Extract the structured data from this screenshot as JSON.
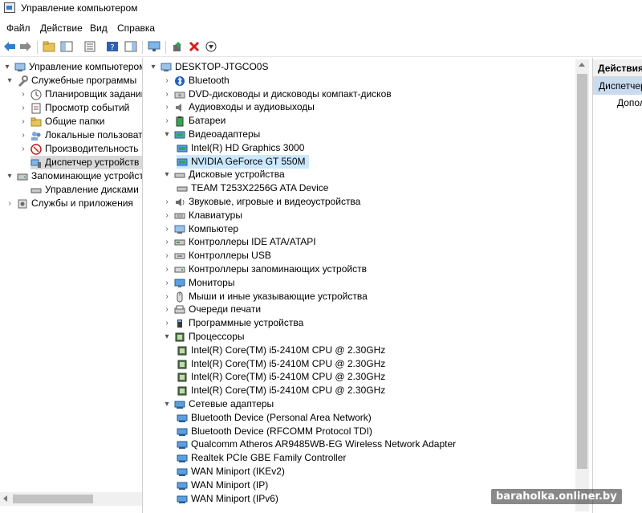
{
  "window": {
    "title": "Управление компьютером"
  },
  "menu": {
    "items": [
      "Файл",
      "Действие",
      "Вид",
      "Справка"
    ]
  },
  "toolbar": {
    "buttons": [
      "back-icon",
      "forward-icon",
      "up-folder-icon",
      "show-hide-tree-icon",
      "properties-icon",
      "help-icon",
      "action-pane-icon",
      "display-icon",
      "update-driver-icon",
      "uninstall-icon",
      "disable-device-icon"
    ]
  },
  "left_tree": {
    "items": [
      {
        "label": "Управление компьютером (л",
        "icon": "computer-management-icon",
        "expander": "▾"
      },
      {
        "label": "Служебные программы",
        "icon": "tools-icon",
        "expander": "▾"
      },
      {
        "label": "Планировщик заданий",
        "icon": "task-scheduler-icon",
        "expander": "›"
      },
      {
        "label": "Просмотр событий",
        "icon": "event-viewer-icon",
        "expander": "›"
      },
      {
        "label": "Общие папки",
        "icon": "shared-folders-icon",
        "expander": "›"
      },
      {
        "label": "Локальные пользовате",
        "icon": "local-users-icon",
        "expander": "›"
      },
      {
        "label": "Производительность",
        "icon": "performance-icon",
        "expander": "›"
      },
      {
        "label": "Диспетчер устройств",
        "icon": "device-manager-icon",
        "expander": ""
      },
      {
        "label": "Запоминающие устройст",
        "icon": "storage-icon",
        "expander": "▾"
      },
      {
        "label": "Управление дисками",
        "icon": "disk-management-icon",
        "expander": ""
      },
      {
        "label": "Службы и приложения",
        "icon": "services-icon",
        "expander": "›"
      }
    ]
  },
  "device_tree": {
    "root": "DESKTOP-JTGCO0S",
    "items": [
      {
        "label": "Bluetooth",
        "icon": "bluetooth-icon",
        "expander": "›"
      },
      {
        "label": "DVD-дисководы и дисководы компакт-дисков",
        "icon": "dvd-drive-icon",
        "expander": "›"
      },
      {
        "label": "Аудиовходы и аудиовыходы",
        "icon": "audio-icon",
        "expander": "›"
      },
      {
        "label": "Батареи",
        "icon": "battery-icon",
        "expander": "›"
      },
      {
        "label": "Видеоадаптеры",
        "icon": "display-adapter-icon",
        "expander": "▾"
      },
      {
        "label": "Intel(R) HD Graphics 3000",
        "icon": "display-adapter-icon",
        "expander": ""
      },
      {
        "label": "NVIDIA GeForce GT 550M",
        "icon": "display-adapter-icon",
        "expander": ""
      },
      {
        "label": "Дисковые устройства",
        "icon": "disk-drive-icon",
        "expander": "▾"
      },
      {
        "label": "TEAM T253X2256G ATA Device",
        "icon": "disk-drive-icon",
        "expander": ""
      },
      {
        "label": "Звуковые, игровые и видеоустройства",
        "icon": "sound-icon",
        "expander": "›"
      },
      {
        "label": "Клавиатуры",
        "icon": "keyboard-icon",
        "expander": "›"
      },
      {
        "label": "Компьютер",
        "icon": "computer-icon",
        "expander": "›"
      },
      {
        "label": "Контроллеры IDE ATA/ATAPI",
        "icon": "ide-controller-icon",
        "expander": "›"
      },
      {
        "label": "Контроллеры USB",
        "icon": "usb-icon",
        "expander": "›"
      },
      {
        "label": "Контроллеры запоминающих устройств",
        "icon": "storage-controller-icon",
        "expander": "›"
      },
      {
        "label": "Мониторы",
        "icon": "monitor-icon",
        "expander": "›"
      },
      {
        "label": "Мыши и иные указывающие устройства",
        "icon": "mouse-icon",
        "expander": "›"
      },
      {
        "label": "Очереди печати",
        "icon": "printer-icon",
        "expander": "›"
      },
      {
        "label": "Программные устройства",
        "icon": "software-device-icon",
        "expander": "›"
      },
      {
        "label": "Процессоры",
        "icon": "processor-icon",
        "expander": "▾"
      },
      {
        "label": "Intel(R) Core(TM) i5-2410M CPU @ 2.30GHz",
        "icon": "processor-icon",
        "expander": ""
      },
      {
        "label": "Intel(R) Core(TM) i5-2410M CPU @ 2.30GHz",
        "icon": "processor-icon",
        "expander": ""
      },
      {
        "label": "Intel(R) Core(TM) i5-2410M CPU @ 2.30GHz",
        "icon": "processor-icon",
        "expander": ""
      },
      {
        "label": "Intel(R) Core(TM) i5-2410M CPU @ 2.30GHz",
        "icon": "processor-icon",
        "expander": ""
      },
      {
        "label": "Сетевые адаптеры",
        "icon": "network-adapter-icon",
        "expander": "▾"
      },
      {
        "label": "Bluetooth Device (Personal Area Network)",
        "icon": "network-adapter-icon",
        "expander": ""
      },
      {
        "label": "Bluetooth Device (RFCOMM Protocol TDI)",
        "icon": "network-adapter-icon",
        "expander": ""
      },
      {
        "label": "Qualcomm Atheros AR9485WB-EG Wireless Network Adapter",
        "icon": "network-adapter-icon",
        "expander": ""
      },
      {
        "label": "Realtek PCIe GBE Family Controller",
        "icon": "network-adapter-icon",
        "expander": ""
      },
      {
        "label": "WAN Miniport (IKEv2)",
        "icon": "network-adapter-icon",
        "expander": ""
      },
      {
        "label": "WAN Miniport (IP)",
        "icon": "network-adapter-icon",
        "expander": ""
      },
      {
        "label": "WAN Miniport (IPv6)",
        "icon": "network-adapter-icon",
        "expander": ""
      }
    ]
  },
  "actions_pane": {
    "header": "Действия",
    "item": "Диспетчер",
    "sub": "Допол"
  },
  "watermark": "baraholka.onliner.by",
  "colors": {
    "selection": "#cce8ff",
    "actions_selection": "#c9dbee",
    "accent": "#3a7bd5"
  }
}
